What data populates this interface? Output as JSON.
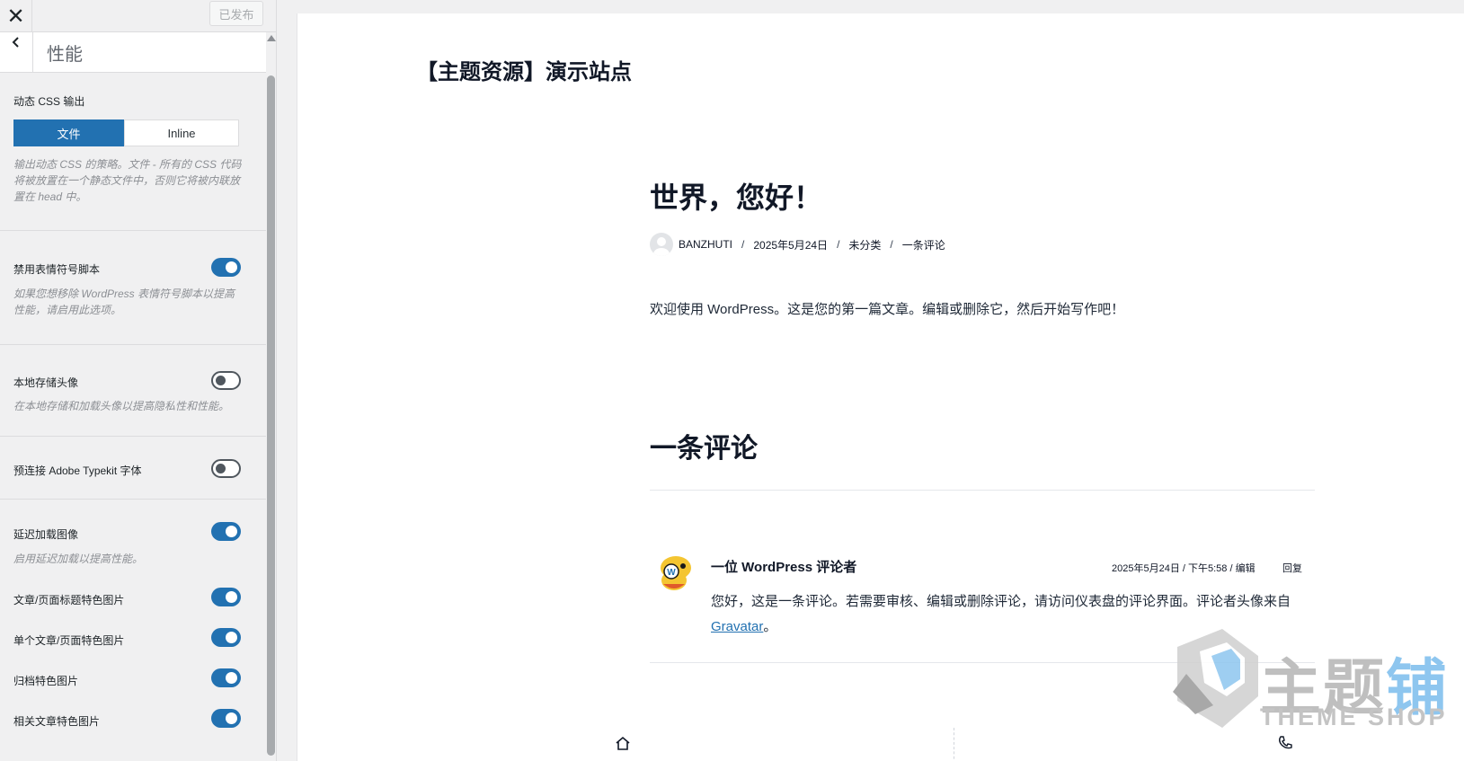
{
  "sidebar": {
    "publish_label": "已发布",
    "section_title": "性能",
    "css_output": {
      "label": "动态 CSS 输出",
      "option_file": "文件",
      "option_inline": "Inline",
      "selected": "文件",
      "description": "输出动态 CSS 的策略。文件 - 所有的 CSS 代码将被放置在一个静态文件中，否则它将被内联放置在 head 中。"
    },
    "disable_emoji": {
      "label": "禁用表情符号脚本",
      "description": "如果您想移除 WordPress 表情符号脚本以提高性能，请启用此选项。",
      "on": true
    },
    "local_avatars": {
      "label": "本地存储头像",
      "description": "在本地存储和加载头像以提高隐私性和性能。",
      "on": false
    },
    "preconnect_typekit": {
      "label": "预连接 Adobe Typekit 字体",
      "on": false
    },
    "lazy_load": {
      "label": "延迟加载图像",
      "description": "启用延迟加载以提高性能。",
      "on": true
    },
    "featured_title": {
      "label": "文章/页面标题特色图片",
      "on": true
    },
    "featured_single": {
      "label": "单个文章/页面特色图片",
      "on": true
    },
    "featured_archive": {
      "label": "归档特色图片",
      "on": true
    },
    "featured_related": {
      "label": "相关文章特色图片",
      "on": true
    },
    "accent_color": "#2271b1"
  },
  "preview": {
    "site_title": "【主题资源】演示站点",
    "post_title": "世界，您好！",
    "meta": {
      "author": "BANZHUTI",
      "date": "2025年5月24日",
      "category": "未分类",
      "comments": "一条评论",
      "separator": "/"
    },
    "content": "欢迎使用 WordPress。这是您的第一篇文章。编辑或删除它，然后开始写作吧！",
    "comments_heading": "一条评论",
    "comment": {
      "author": "一位 WordPress 评论者",
      "date": "2025年5月24日 / 下午5:58 / 编辑",
      "reply": "回复",
      "text_before": "您好，这是一条评论。若需要审核、编辑或删除评论，请访问仪表盘的评论界面。评论者头像来自 ",
      "link": "Gravatar",
      "text_after": "。"
    }
  },
  "watermark": {
    "text_gray": "主题",
    "text_blue": "铺",
    "sub": "THEME SHOP"
  }
}
